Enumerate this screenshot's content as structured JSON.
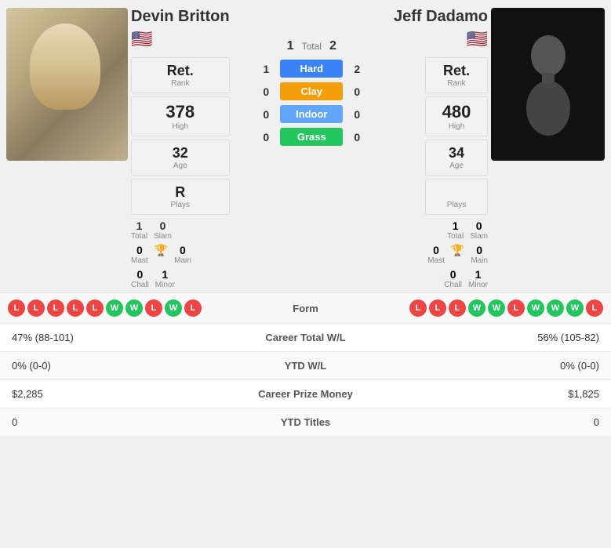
{
  "left_player": {
    "name": "Devin Britton",
    "flag": "🇺🇸",
    "rank_label": "Ret.",
    "rank_sub": "Rank",
    "high": "378",
    "high_label": "High",
    "age": "32",
    "age_label": "Age",
    "plays": "R",
    "plays_label": "Plays",
    "total": "1",
    "total_label": "Total",
    "slam": "0",
    "slam_label": "Slam",
    "mast": "0",
    "mast_label": "Mast",
    "main": "0",
    "main_label": "Main",
    "chall": "0",
    "chall_label": "Chall",
    "minor": "1",
    "minor_label": "Minor"
  },
  "right_player": {
    "name": "Jeff Dadamo",
    "flag": "🇺🇸",
    "rank_label": "Ret.",
    "rank_sub": "Rank",
    "high": "480",
    "high_label": "High",
    "age": "34",
    "age_label": "Age",
    "plays": "",
    "plays_label": "Plays",
    "total": "1",
    "total_label": "Total",
    "slam": "0",
    "slam_label": "Slam",
    "mast": "0",
    "mast_label": "Mast",
    "main": "0",
    "main_label": "Main",
    "chall": "0",
    "chall_label": "Chall",
    "minor": "1",
    "minor_label": "Minor"
  },
  "center": {
    "total_left": "1",
    "total_right": "2",
    "total_label": "Total",
    "hard_left": "1",
    "hard_right": "2",
    "hard_label": "Hard",
    "clay_left": "0",
    "clay_right": "0",
    "clay_label": "Clay",
    "indoor_left": "0",
    "indoor_right": "0",
    "indoor_label": "Indoor",
    "grass_left": "0",
    "grass_right": "0",
    "grass_label": "Grass"
  },
  "form": {
    "label": "Form",
    "left_form": [
      "L",
      "L",
      "L",
      "L",
      "L",
      "W",
      "W",
      "L",
      "W",
      "L"
    ],
    "right_form": [
      "L",
      "L",
      "L",
      "W",
      "W",
      "L",
      "W",
      "W",
      "W",
      "L"
    ]
  },
  "stats": [
    {
      "label": "Career Total W/L",
      "left": "47% (88-101)",
      "right": "56% (105-82)"
    },
    {
      "label": "YTD W/L",
      "left": "0% (0-0)",
      "right": "0% (0-0)"
    },
    {
      "label": "Career Prize Money",
      "left": "$2,285",
      "right": "$1,825"
    },
    {
      "label": "YTD Titles",
      "left": "0",
      "right": "0"
    }
  ]
}
